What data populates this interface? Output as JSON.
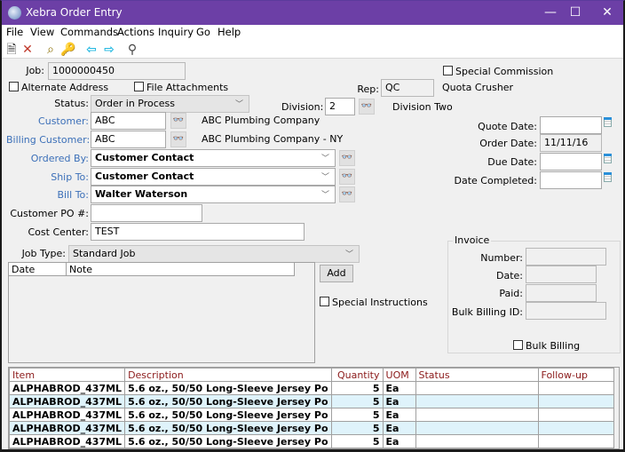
{
  "window": {
    "title": "Xebra Order Entry",
    "controls": {
      "minimize": "—",
      "maximize": "☐",
      "close": "✕"
    }
  },
  "menu": [
    "File",
    "View",
    "Commands",
    "Actions",
    "Inquiry",
    "Go",
    "Help"
  ],
  "toolbar": {
    "icons": [
      "new-document-icon",
      "delete-icon",
      "find-icon",
      "key-icon",
      "back-arrow-icon",
      "forward-arrow-icon",
      "search-binoculars-icon"
    ],
    "glyphs": [
      "🗎",
      "✕",
      "⌕",
      "🔑",
      "⇦",
      "⇨",
      "⚲"
    ]
  },
  "form": {
    "job": {
      "label": "Job:",
      "value": "1000000450"
    },
    "alternate_address": {
      "label": "Alternate Address",
      "checked": false
    },
    "file_attachments": {
      "label": "File Attachments",
      "checked": false
    },
    "special_commission": {
      "label": "Special Commission",
      "checked": false
    },
    "rep": {
      "label": "Rep:",
      "value": "QC",
      "name": "Quota Crusher"
    },
    "status": {
      "label": "Status:",
      "value": "Order in Process"
    },
    "division": {
      "label": "Division:",
      "value": "2",
      "name": "Division Two"
    },
    "customer": {
      "label": "Customer:",
      "value": "ABC",
      "name": "ABC Plumbing Company"
    },
    "billing_customer": {
      "label": "Billing Customer:",
      "value": "ABC",
      "name": "ABC Plumbing Company - NY"
    },
    "ordered_by": {
      "label": "Ordered By:",
      "value": "Customer Contact"
    },
    "ship_to": {
      "label": "Ship To:",
      "value": "Customer Contact"
    },
    "bill_to": {
      "label": "Bill To:",
      "value": "Walter Waterson"
    },
    "customer_po": {
      "label": "Customer PO #:",
      "value": ""
    },
    "cost_center": {
      "label": "Cost Center:",
      "value": "TEST"
    },
    "job_type": {
      "label": "Job Type:",
      "value": "Standard Job"
    },
    "quote_date": {
      "label": "Quote Date:",
      "value": ""
    },
    "order_date": {
      "label": "Order Date:",
      "value": "11/11/16"
    },
    "due_date": {
      "label": "Due Date:",
      "value": ""
    },
    "date_completed": {
      "label": "Date Completed:",
      "value": ""
    }
  },
  "notes": {
    "columns": [
      "Date",
      "Note"
    ],
    "add_label": "Add",
    "special_instructions": {
      "label": "Special Instructions",
      "checked": false
    }
  },
  "invoice": {
    "title": "Invoice",
    "number": {
      "label": "Number:",
      "value": ""
    },
    "date": {
      "label": "Date:",
      "value": ""
    },
    "paid": {
      "label": "Paid:",
      "value": ""
    },
    "bulk_billing_id": {
      "label": "Bulk Billing ID:",
      "value": ""
    },
    "bulk_billing": {
      "label": "Bulk Billing",
      "checked": false
    }
  },
  "items": {
    "columns": [
      "Item",
      "Description",
      "Quantity",
      "UOM",
      "Status",
      "Follow-up"
    ],
    "rows": [
      {
        "item": "ALPHABROD_437ML",
        "description": "5.6 oz., 50/50 Long-Sleeve Jersey Po",
        "quantity": "5",
        "uom": "Ea",
        "status": "",
        "followup": ""
      },
      {
        "item": "ALPHABROD_437ML",
        "description": "5.6 oz., 50/50 Long-Sleeve Jersey Po",
        "quantity": "5",
        "uom": "Ea",
        "status": "",
        "followup": ""
      },
      {
        "item": "ALPHABROD_437ML",
        "description": "5.6 oz., 50/50 Long-Sleeve Jersey Po",
        "quantity": "5",
        "uom": "Ea",
        "status": "",
        "followup": ""
      },
      {
        "item": "ALPHABROD_437ML",
        "description": "5.6 oz., 50/50 Long-Sleeve Jersey Po",
        "quantity": "5",
        "uom": "Ea",
        "status": "",
        "followup": ""
      },
      {
        "item": "ALPHABROD_437ML",
        "description": "5.6 oz., 50/50 Long-Sleeve Jersey Po",
        "quantity": "5",
        "uom": "Ea",
        "status": "",
        "followup": ""
      }
    ]
  },
  "colors": {
    "titlebar": "#6c3fa6",
    "link_label": "#3b6fb8",
    "grid_header": "#8b1a1a",
    "row_alt": "#dff3fb"
  }
}
